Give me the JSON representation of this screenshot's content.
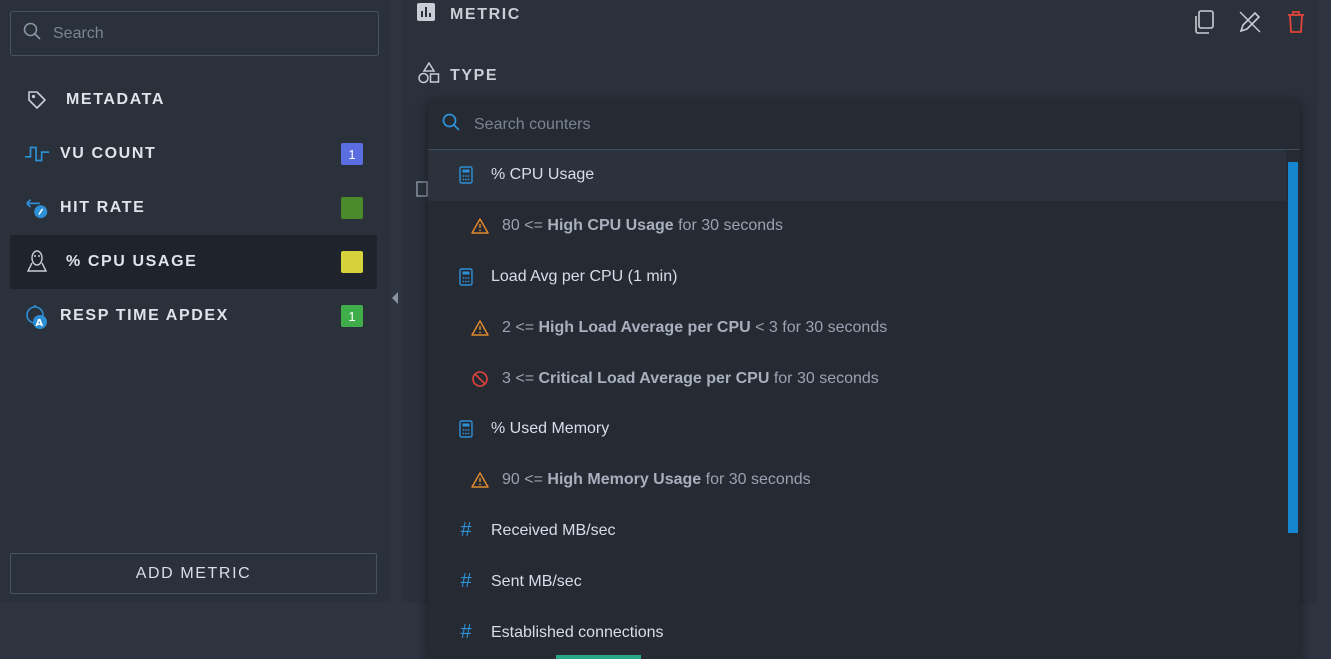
{
  "sidebar": {
    "search_placeholder": "Search",
    "items": [
      {
        "label": "METADATA",
        "badge": null
      },
      {
        "label": "VU COUNT",
        "badge": "1",
        "badge_color": "#5b6ee1"
      },
      {
        "label": "HIT RATE",
        "badge": "",
        "badge_color": "#4a8a2a"
      },
      {
        "label": "% CPU USAGE",
        "badge": "",
        "badge_color": "#d6d23a"
      },
      {
        "label": "RESP TIME APDEX",
        "badge": "1",
        "badge_color": "#3fae4a"
      }
    ],
    "add_metric_label": "ADD METRIC"
  },
  "main": {
    "metric_title": "METRIC",
    "type_title": "TYPE"
  },
  "dropdown": {
    "search_placeholder": "Search counters",
    "rows": [
      {
        "kind": "counter",
        "icon": "calculator-icon",
        "label": "% CPU Usage"
      },
      {
        "kind": "threshold",
        "icon": "warning-icon",
        "prefix": "80 <=",
        "name": "High CPU Usage",
        "suffix": "for 30 seconds"
      },
      {
        "kind": "counter",
        "icon": "calculator-icon",
        "label": "Load Avg per CPU (1 min)"
      },
      {
        "kind": "threshold",
        "icon": "warning-icon",
        "prefix": "2 <=",
        "name": "High Load Average per CPU",
        "suffix": "< 3 for 30 seconds"
      },
      {
        "kind": "threshold",
        "icon": "forbidden-icon",
        "prefix": "3 <=",
        "name": "Critical Load Average per CPU",
        "suffix": "for 30 seconds"
      },
      {
        "kind": "counter",
        "icon": "calculator-icon",
        "label": "% Used Memory"
      },
      {
        "kind": "threshold",
        "icon": "warning-icon",
        "prefix": "90 <=",
        "name": "High Memory Usage",
        "suffix": "for 30 seconds"
      },
      {
        "kind": "counter",
        "icon": "hash-icon",
        "label": "Received MB/sec"
      },
      {
        "kind": "counter",
        "icon": "hash-icon",
        "label": "Sent MB/sec"
      },
      {
        "kind": "counter",
        "icon": "hash-icon",
        "label": "Established connections"
      }
    ]
  },
  "colors": {
    "accent": "#2d8fd5",
    "warning": "#e0882c",
    "critical": "#e0443a",
    "delete": "#e0443a"
  }
}
